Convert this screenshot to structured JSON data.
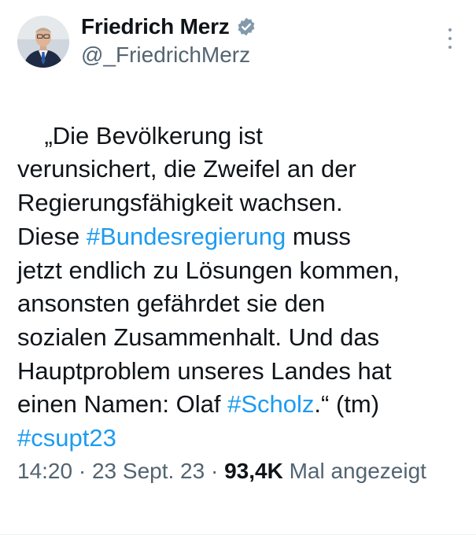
{
  "author": {
    "display_name": "Friedrich Merz",
    "handle": "@_FriedrichMerz",
    "verified_icon": "verified-badge-icon",
    "badge_color": "#829aab"
  },
  "tweet": {
    "segments": [
      {
        "text": "„Die Bevölkerung ist\nverunsichert, die Zweifel an der\nRegierungsfähigkeit wachsen.\nDiese ",
        "hashtag": false
      },
      {
        "text": "#Bundesregierung",
        "hashtag": true
      },
      {
        "text": " muss\njetzt endlich zu Lösungen kommen,\nansonsten gefährdet sie den\nsozialen Zusammenhalt. Und das\nHauptproblem unseres Landes hat\neinen Namen: Olaf ",
        "hashtag": false
      },
      {
        "text": "#Scholz",
        "hashtag": true
      },
      {
        "text": ".“ (tm)\n",
        "hashtag": false
      },
      {
        "text": "#csupt23",
        "hashtag": true
      }
    ]
  },
  "meta": {
    "time": "14:20",
    "separator": " · ",
    "date": "23 Sept. 23",
    "views_count": "93,4K",
    "views_label": " Mal angezeigt"
  },
  "colors": {
    "link": "#1d9bf0",
    "text": "#0f1419",
    "muted": "#536471"
  }
}
